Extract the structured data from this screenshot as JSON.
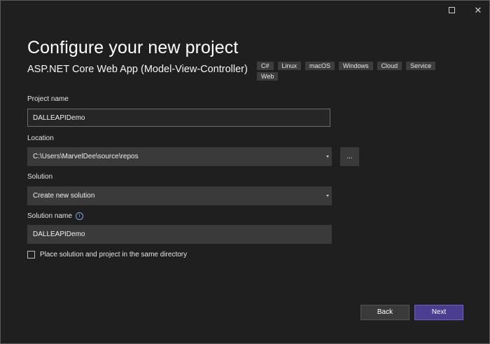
{
  "window": {
    "maximize_icon": "maximize-icon",
    "close_glyph": "✕"
  },
  "page": {
    "title": "Configure your new project",
    "template_name": "ASP.NET Core Web App (Model-View-Controller)",
    "tags": [
      "C#",
      "Linux",
      "macOS",
      "Windows",
      "Cloud",
      "Service",
      "Web"
    ]
  },
  "form": {
    "project_name": {
      "label": "Project name",
      "value": "DALLEAPIDemo"
    },
    "location": {
      "label": "Location",
      "value": "C:\\Users\\MarvelDee\\source\\repos",
      "browse_label": "..."
    },
    "solution": {
      "label": "Solution",
      "value": "Create new solution"
    },
    "solution_name": {
      "label": "Solution name",
      "info_glyph": "i",
      "value": "DALLEAPIDemo"
    },
    "same_directory": {
      "label": "Place solution and project in the same directory",
      "checked": false
    }
  },
  "footer": {
    "back_label": "Back",
    "next_label": "Next"
  },
  "colors": {
    "background": "#1f1f1f",
    "field": "#3a3a3a",
    "accent": "#4b3d8f"
  }
}
